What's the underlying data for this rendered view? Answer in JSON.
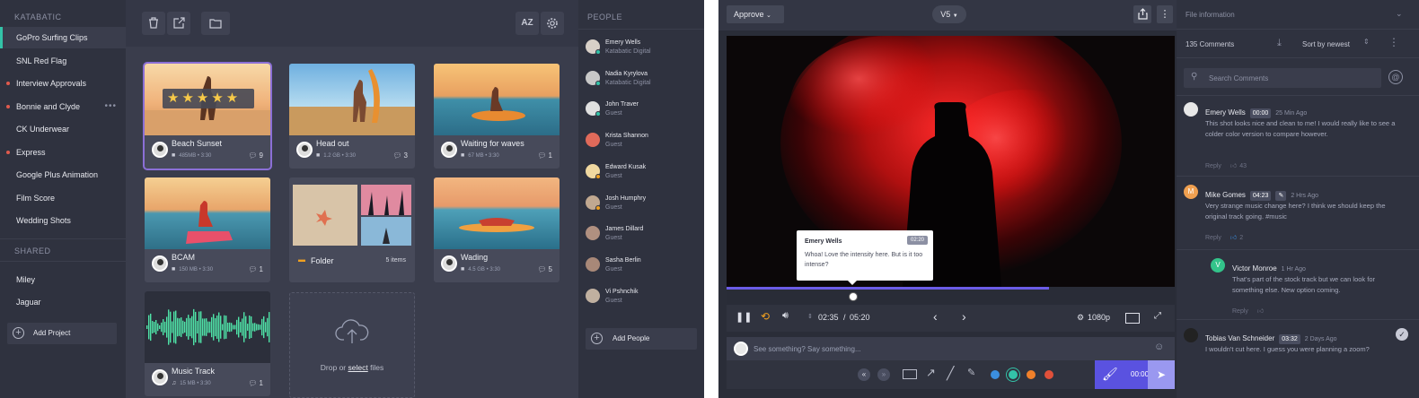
{
  "left_app": {
    "sidebar": {
      "section_title": "KATABATIC",
      "projects": [
        {
          "label": "GoPro Surfing Clips",
          "active": true,
          "alert": false
        },
        {
          "label": "SNL Red Flag",
          "active": false,
          "alert": false
        },
        {
          "label": "Interview Approvals",
          "active": false,
          "alert": true
        },
        {
          "label": "Bonnie and Clyde",
          "active": false,
          "alert": true
        },
        {
          "label": "CK Underwear",
          "active": false,
          "alert": false
        },
        {
          "label": "Express",
          "active": false,
          "alert": true
        },
        {
          "label": "Google Plus Animation",
          "active": false,
          "alert": false
        },
        {
          "label": "Film Score",
          "active": false,
          "alert": false
        },
        {
          "label": "Wedding Shots",
          "active": false,
          "alert": false
        }
      ],
      "more_label": "•••",
      "shared_title": "SHARED",
      "shared": [
        "Miley",
        "Jaguar"
      ],
      "add_project": "Add Project"
    },
    "toolbar": {
      "sort_label": "AZ"
    },
    "cards": [
      {
        "name": "Beach Sunset",
        "meta": "485MB • 3:30",
        "comments": "9",
        "kind": "video",
        "selected": true,
        "rating": 4
      },
      {
        "name": "Head out",
        "meta": "1.2 GB • 3:30",
        "comments": "3",
        "kind": "video"
      },
      {
        "name": "Waiting for waves",
        "meta": "67 MB • 3:30",
        "comments": "1",
        "kind": "video"
      },
      {
        "name": "BCAM",
        "meta": "150 MB • 3:30",
        "comments": "1",
        "kind": "video"
      },
      {
        "name": "Folder",
        "meta": "5 items",
        "comments": "",
        "kind": "folder"
      },
      {
        "name": "Wading",
        "meta": "4.5 GB • 3:30",
        "comments": "5",
        "kind": "video"
      },
      {
        "name": "Music Track",
        "meta": "15 MB • 3:30",
        "comments": "1",
        "kind": "audio"
      }
    ],
    "dropzone": {
      "prefix": "Drop or ",
      "link": "select",
      "suffix": " files"
    },
    "people": {
      "title": "PEOPLE",
      "list": [
        {
          "name": "Emery Wells",
          "org": "Katabatic Digital",
          "status": "#33c3a8"
        },
        {
          "name": "Nadia Kyrylova",
          "org": "Katabatic Digital",
          "status": "#33c3a8"
        },
        {
          "name": "John Traver",
          "org": "Guest",
          "status": "#33c3a8"
        },
        {
          "name": "Krista Shannon",
          "org": "Guest",
          "status": ""
        },
        {
          "name": "Edward Kusak",
          "org": "Guest",
          "status": "#f0a020"
        },
        {
          "name": "Josh Humphry",
          "org": "Guest",
          "status": "#f0a020"
        },
        {
          "name": "James Dillard",
          "org": "Guest",
          "status": ""
        },
        {
          "name": "Sasha Berlin",
          "org": "Guest",
          "status": ""
        },
        {
          "name": "Vi Pshnchik",
          "org": "Guest",
          "status": ""
        }
      ],
      "add_people": "Add People"
    }
  },
  "right_app": {
    "approve_label": "Approve",
    "version_label": "V5",
    "tooltip": {
      "name": "Emery Wells",
      "timecode": "02:20",
      "text": "Whoa! Love the intensity here. But is it too intense?"
    },
    "playback": {
      "current": "02:35",
      "duration": "05:20",
      "progress": 0.72,
      "quality": "1080p"
    },
    "comment_input_placeholder": "See something? Say something...",
    "draw_timecode": "00:00",
    "draw_colors": [
      "#3b8fe0",
      "#33c3a8",
      "#f0802a",
      "#e0503a"
    ],
    "panel": {
      "title": "File information",
      "count": "135 Comments",
      "sort": "Sort by newest",
      "search_placeholder": "Search Comments",
      "comments": [
        {
          "name": "Emery Wells",
          "tc": "00:00",
          "ago": "25 Min Ago",
          "body": "This shot looks nice and clean to me! I would really like to see a colder color version to compare however.",
          "reply": "Reply",
          "likes": "43",
          "avatar": "#e8e8e8"
        },
        {
          "name": "Mike Gomes",
          "tc": "04:23",
          "ago": "2 Hrs Ago",
          "body": "Very strange music change here? I think we should keep the original track going. #music",
          "reply": "Reply",
          "likes": "2",
          "avatar": "#f0a050",
          "initial": "M"
        },
        {
          "name": "Victor Monroe",
          "tc": "",
          "ago": "1 Hr Ago",
          "body": "That's part of the stock track but we can look for something else. New option coming.",
          "reply": "Reply",
          "likes": "",
          "avatar": "#33c38a",
          "initial": "V"
        },
        {
          "name": "Tobias Van Schneider",
          "tc": "03:32",
          "ago": "2 Days Ago",
          "body": "I wouldn't cut here. I guess you were planning a zoom?",
          "reply": "",
          "likes": "",
          "avatar": "#222"
        }
      ]
    }
  }
}
